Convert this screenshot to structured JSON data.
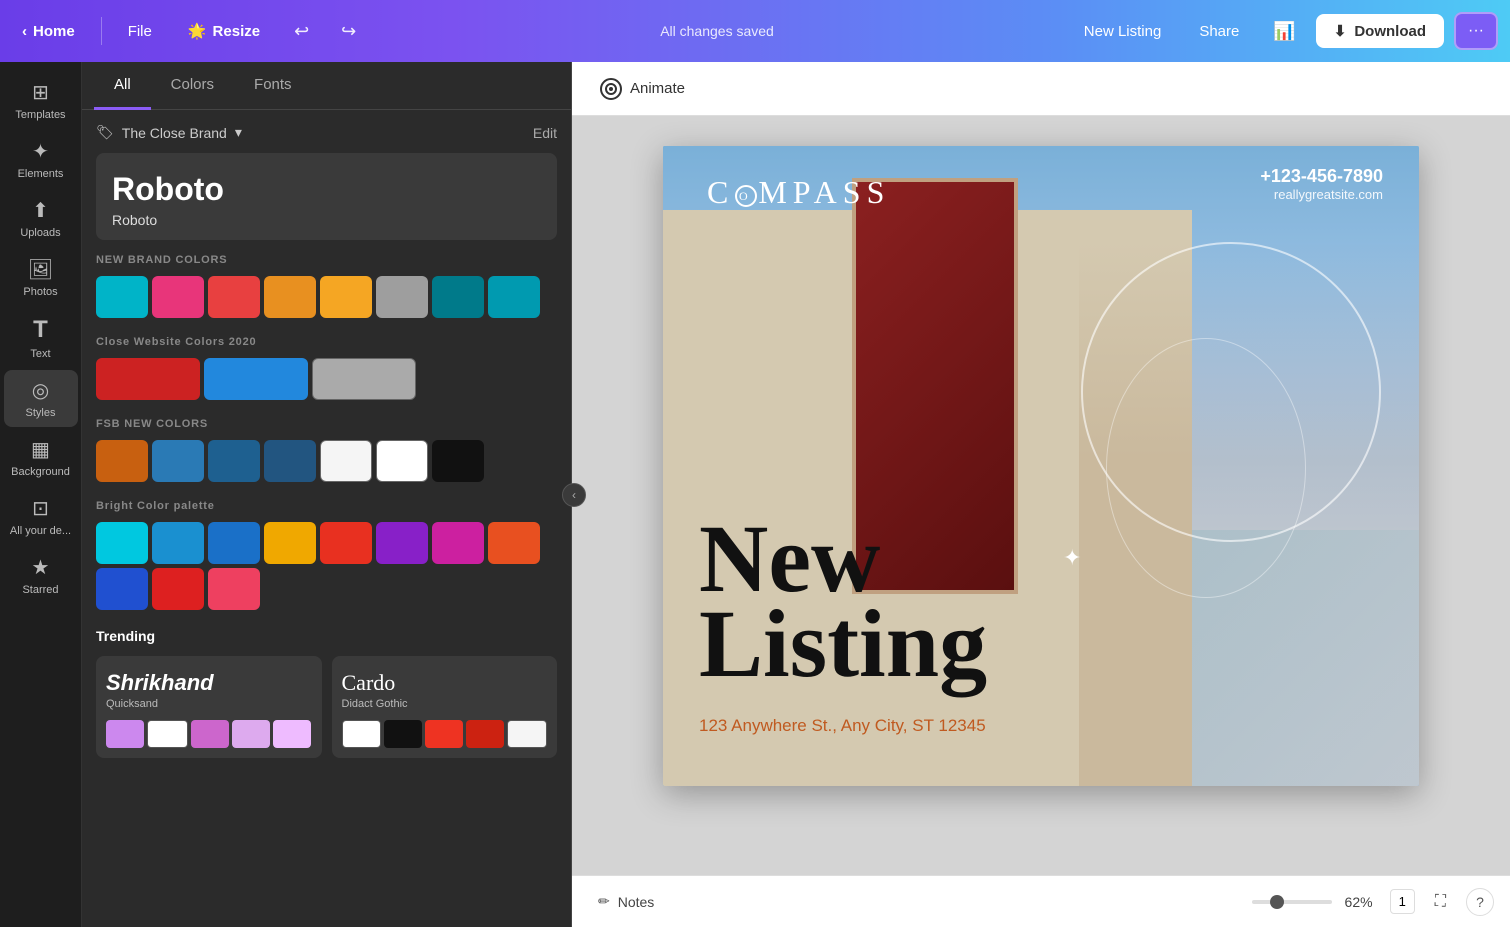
{
  "header": {
    "home_label": "Home",
    "file_label": "File",
    "resize_label": "Resize",
    "resize_emoji": "🌟",
    "undo_icon": "↩",
    "redo_icon": "↪",
    "saved_status": "All changes saved",
    "new_listing_label": "New Listing",
    "share_label": "Share",
    "download_label": "Download",
    "more_icon": "···"
  },
  "left_sidebar": {
    "items": [
      {
        "id": "templates",
        "label": "Templates",
        "icon": "⊞"
      },
      {
        "id": "elements",
        "label": "Elements",
        "icon": "✦"
      },
      {
        "id": "uploads",
        "label": "Uploads",
        "icon": "⬆"
      },
      {
        "id": "photos",
        "label": "Photos",
        "icon": "🖼"
      },
      {
        "id": "text",
        "label": "Text",
        "icon": "T"
      },
      {
        "id": "styles",
        "label": "Styles",
        "icon": "◎"
      },
      {
        "id": "background",
        "label": "Background",
        "icon": "▦"
      },
      {
        "id": "all-your-designs",
        "label": "All your de...",
        "icon": "⊡"
      },
      {
        "id": "starred",
        "label": "Starred",
        "icon": "★"
      }
    ]
  },
  "panel": {
    "tabs": [
      {
        "id": "all",
        "label": "All",
        "active": true
      },
      {
        "id": "colors",
        "label": "Colors"
      },
      {
        "id": "fonts",
        "label": "Fonts"
      }
    ],
    "brand": {
      "name": "The Close Brand",
      "icon": "🏷",
      "edit_label": "Edit"
    },
    "font_preview": {
      "large": "Roboto",
      "small": "Roboto"
    },
    "color_sections": [
      {
        "title": "NEW BRAND COLORS",
        "swatches": [
          "#00b4c8",
          "#e8357a",
          "#e84040",
          "#e89020",
          "#f5a623",
          "#9e9e9e",
          "#888888",
          "#007a8a",
          "#009ab0"
        ]
      },
      {
        "title": "Close Website Colors 2020",
        "swatches": [
          "#cc2222",
          "#dd3333",
          "#2288dd",
          "#3399ee",
          "#cccccc",
          "#aaaaaa"
        ]
      },
      {
        "title": "FSB NEW COLORS",
        "swatches": [
          "#c86010",
          "#2a7ab5",
          "#1e6090",
          "#225580",
          "#f5f5f5",
          "#ffffff",
          "#111111",
          "#000000"
        ]
      },
      {
        "title": "Bright Color palette",
        "swatches": [
          "#00c8e0",
          "#1a90d0",
          "#1a70c8",
          "#f0a800",
          "#e83020",
          "#8820c8",
          "#cc20a0",
          "#e85020",
          "#2050d0",
          "#dd2020",
          "#ee4060"
        ]
      }
    ],
    "trending": {
      "title": "Trending",
      "cards": [
        {
          "font_large": "Shrikhand",
          "font_small": "Quicksand",
          "swatches": [
            "#cc88ee",
            "#ffffff",
            "#cc66cc",
            "#ddaaee",
            "#eebbff"
          ]
        },
        {
          "font_large": "Cardo",
          "font_small": "Didact Gothic",
          "swatches": [
            "#ffffff",
            "#111111",
            "#ee3322",
            "#cc2211",
            "#f5f5f5"
          ]
        }
      ]
    }
  },
  "canvas": {
    "animate_label": "Animate",
    "logo": "COMPASS",
    "phone": "+123-456-7890",
    "website": "reallygreatsite.com",
    "title_line1": "New",
    "title_line2": "Listing",
    "address": "123 Anywhere St., Any City, ST 12345"
  },
  "bottom_bar": {
    "notes_icon": "✏",
    "notes_label": "Notes",
    "zoom_value": 62,
    "zoom_pct_label": "62%",
    "page_num": "1",
    "fullscreen_icon": "⛶",
    "help_icon": "?"
  }
}
